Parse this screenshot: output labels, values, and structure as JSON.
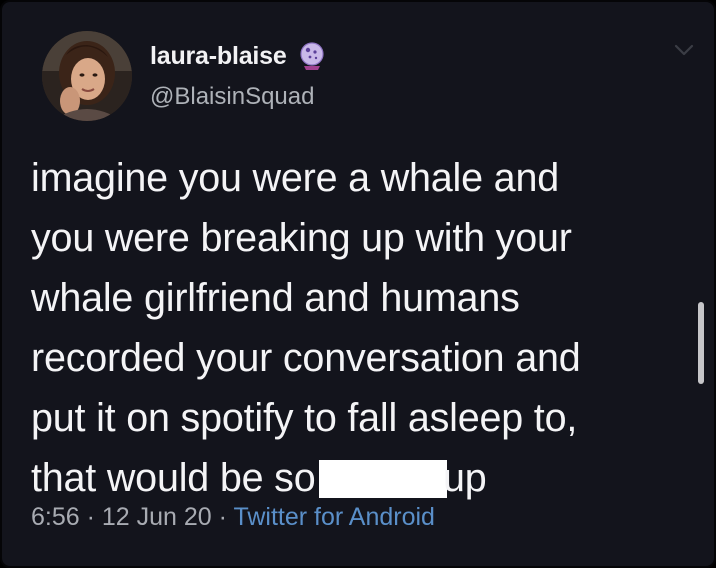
{
  "author": {
    "display_name": "laura-blaise",
    "handle": "@BlaisinSquad",
    "badge_icon": "crystal-ball-icon"
  },
  "tweet": {
    "lines": [
      "imagine you were a whale and",
      "you were breaking up with your",
      "whale girlfriend and humans",
      "recorded your conversation and",
      "put it on spotify to fall asleep to,"
    ],
    "last_line_before": "that would be so f",
    "last_line_after": "up"
  },
  "meta": {
    "time": "6:56",
    "separator_1": " · ",
    "date": "12 Jun 20",
    "separator_2": " · ",
    "source": "Twitter for Android"
  },
  "colors": {
    "background": "#13141c",
    "text": "#f4f4f6",
    "muted": "#a8abb2",
    "link": "#5a8fc9"
  }
}
